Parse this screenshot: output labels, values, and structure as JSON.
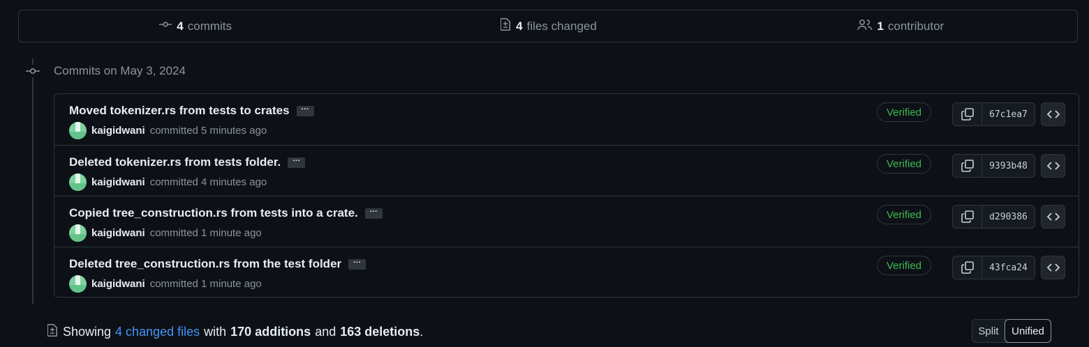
{
  "summary": {
    "commits_count": "4",
    "commits_label": "commits",
    "files_count": "4",
    "files_label": "files changed",
    "contributors_count": "1",
    "contributors_label": "contributor"
  },
  "timeline": {
    "date_heading": "Commits on May 3, 2024"
  },
  "commits": [
    {
      "message": "Moved tokenizer.rs from tests to crates",
      "author": "kaigidwani",
      "committed_text": "committed 5 minutes ago",
      "verified": "Verified",
      "sha": "67c1ea7"
    },
    {
      "message": "Deleted tokenizer.rs from tests folder.",
      "author": "kaigidwani",
      "committed_text": "committed 4 minutes ago",
      "verified": "Verified",
      "sha": "9393b48"
    },
    {
      "message": "Copied tree_construction.rs from tests into a crate.",
      "author": "kaigidwani",
      "committed_text": "committed 1 minute ago",
      "verified": "Verified",
      "sha": "d290386"
    },
    {
      "message": "Deleted tree_construction.rs from the test folder",
      "author": "kaigidwani",
      "committed_text": "committed 1 minute ago",
      "verified": "Verified",
      "sha": "43fca24"
    }
  ],
  "ellipsis_label": "···",
  "files_summary": {
    "prefix": "Showing",
    "changed_link": "4 changed files",
    "with_text": "with",
    "additions": "170 additions",
    "and_text": "and",
    "deletions": "163 deletions",
    "suffix": "."
  },
  "view_toggle": {
    "split_label": "Split",
    "unified_label": "Unified",
    "selected": "Unified"
  },
  "colors": {
    "background": "#0d1117",
    "border": "#30363d",
    "verified_green": "#3fb950",
    "link_blue": "#4493f8"
  },
  "icons": {
    "commits": "git-commit-icon",
    "files": "file-diff-icon",
    "contributors": "people-icon",
    "copy": "copy-icon",
    "browse": "code-icon"
  }
}
